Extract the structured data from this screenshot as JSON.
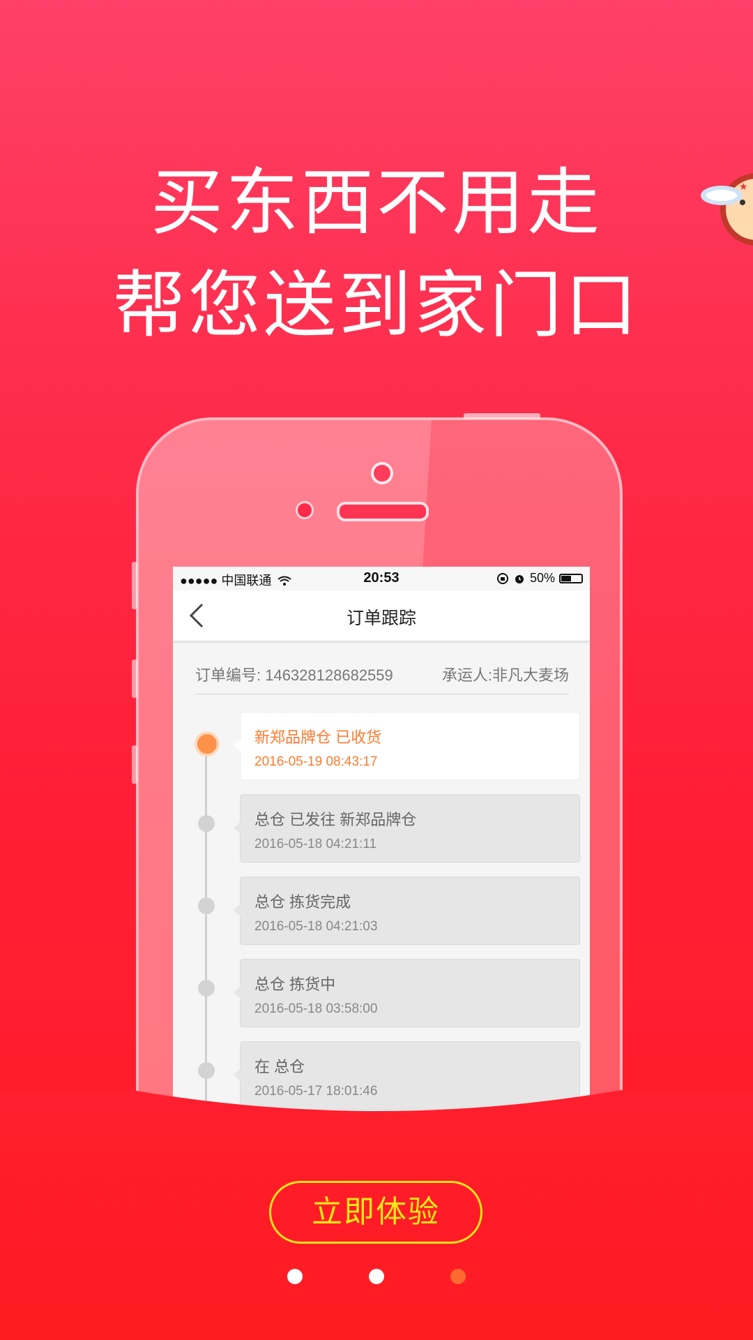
{
  "headline": {
    "line1": "买东西不用走",
    "line2": "帮您送到家门口"
  },
  "phone_screen": {
    "status_bar": {
      "carrier": "●●●●● 中国联通",
      "wifi_icon": "wifi-icon",
      "time": "20:53",
      "battery_percent": "50%",
      "battery_level": 0.5
    },
    "nav": {
      "title": "订单跟踪",
      "back_icon": "chevron-left-icon"
    },
    "order": {
      "number": "订单编号: 146328128682559",
      "carrier": "承运人:非凡大麦场"
    },
    "timeline": [
      {
        "status": "新郑品牌仓 已收货",
        "time": "2016-05-19 08:43:17",
        "active": true
      },
      {
        "status": "总仓 已发往 新郑品牌仓",
        "time": "2016-05-18 04:21:11",
        "active": false
      },
      {
        "status": "总仓 拣货完成",
        "time": "2016-05-18 04:21:03",
        "active": false
      },
      {
        "status": "总仓 拣货中",
        "time": "2016-05-18 03:58:00",
        "active": false
      },
      {
        "status": "在 总仓",
        "time": "2016-05-17 18:01:46",
        "active": false
      }
    ]
  },
  "cta": {
    "label": "立即体验"
  },
  "pager": {
    "count": 3,
    "active_index": 2
  },
  "colors": {
    "accent_orange": "#ff7a2c",
    "cta_yellow": "#ffe817",
    "background_top": "#ff4068",
    "background_bottom": "#ff1c22"
  }
}
